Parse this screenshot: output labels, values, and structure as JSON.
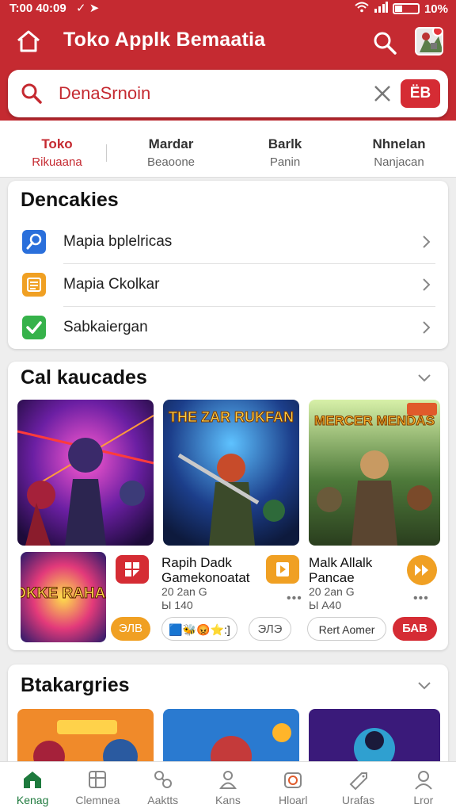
{
  "status_bar": {
    "time": "T:00 40:09",
    "battery": "10%"
  },
  "header": {
    "title": "Toko Applk Bemaatia",
    "avatar_icon": "game-avatar-icon"
  },
  "search": {
    "query": "DenaSrnoin",
    "go_label": "ЁB"
  },
  "tabs": [
    {
      "title": "Toko",
      "subtitle": "Rikuaana",
      "active": true
    },
    {
      "title": "Mardar",
      "subtitle": "Beaoone",
      "active": false
    },
    {
      "title": "Barlk",
      "subtitle": "Panin",
      "active": false
    },
    {
      "title": "Nhnelan",
      "subtitle": "Nanjacan",
      "active": false
    }
  ],
  "section1": {
    "title": "Dencakies",
    "items": [
      {
        "label": "Mapia bplelricas",
        "icon": "blue-tools-icon",
        "color": "#2a6fdb"
      },
      {
        "label": "Mapia Ckolkar",
        "icon": "orange-book-icon",
        "color": "#f0a023"
      },
      {
        "label": "Sabkaiergan",
        "icon": "green-check-icon",
        "color": "#36b24a"
      }
    ]
  },
  "section2": {
    "title": "Cal kaucades",
    "art_titles": {
      "game2": "THE ZAR RUKFAN",
      "game3": "MERCER MENDAS",
      "game4": "HIOKKE RAHAAK"
    },
    "apps": [
      {
        "title_line1": "Rapih Dadk",
        "title_line2": "Gamekonoatat",
        "meta_line1": "20 2an G",
        "meta_line2": "Ы 140",
        "button_color": "#d52c34",
        "pill_label": "ЭЛЭ"
      },
      {
        "title_line1": "Malk Allalk",
        "title_line2": "Pancae",
        "meta_line1": "20 2an G",
        "meta_line2": "Ы A40",
        "button_color": "#f0a023",
        "pill_label": "Rert Aomer",
        "pill2_label": "БАВ"
      }
    ],
    "left_pill_label": "ЭЛВ",
    "emoji_chip": "🟦🐝😡⭐:]"
  },
  "section3": {
    "title": "Btakargries"
  },
  "bottom_nav": [
    {
      "label": "Kenag",
      "icon": "store-icon",
      "active": true
    },
    {
      "label": "Clemnea",
      "icon": "grid-icon",
      "active": false
    },
    {
      "label": "Aaktts",
      "icon": "tools-icon",
      "active": false
    },
    {
      "label": "Kans",
      "icon": "person-icon",
      "active": false
    },
    {
      "label": "Hloarl",
      "icon": "camera-icon",
      "active": false
    },
    {
      "label": "Urafas",
      "icon": "tag-icon",
      "active": false
    },
    {
      "label": "Lror",
      "icon": "user-icon",
      "active": false
    }
  ]
}
